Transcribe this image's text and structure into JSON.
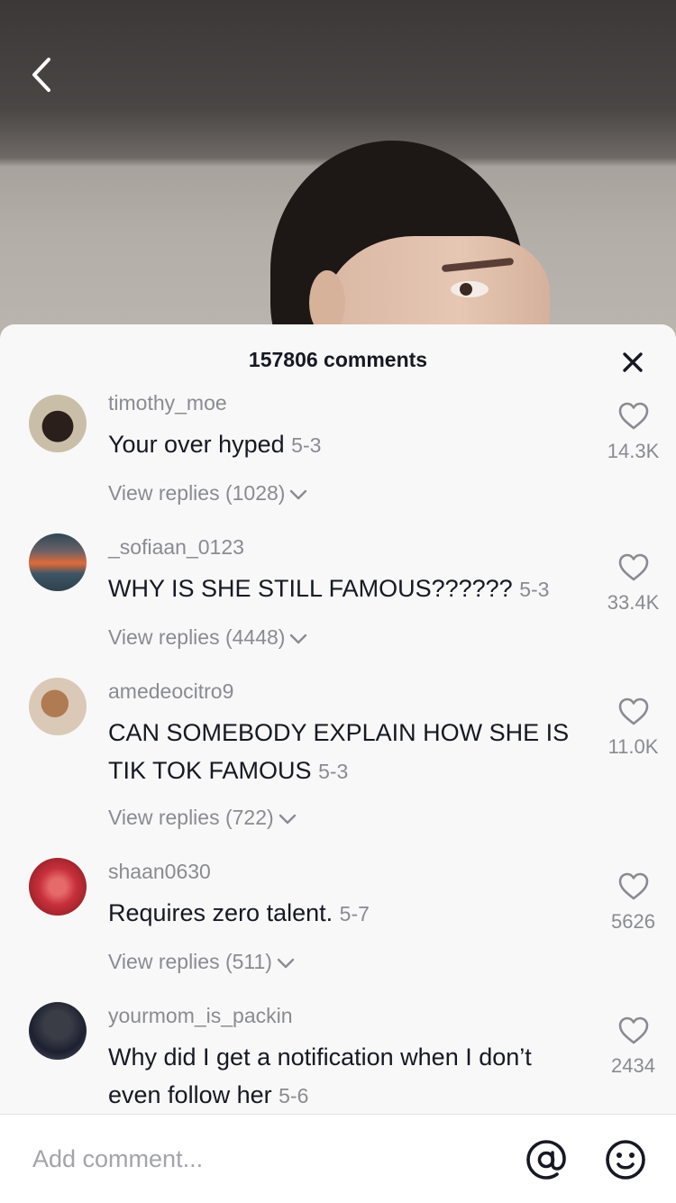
{
  "header": {
    "comment_count": "157806 comments"
  },
  "comments": [
    {
      "username": "timothy_moe",
      "text": "Your over hyped",
      "date": "5-3",
      "replies": "View replies (1028)",
      "likes": "14.3K"
    },
    {
      "username": "_sofiaan_0123",
      "text": "WHY IS SHE STILL FAMOUS??????",
      "date": "5-3",
      "replies": "View replies (4448)",
      "likes": "33.4K"
    },
    {
      "username": "amedeocitro9",
      "text": "CAN SOMEBODY EXPLAIN HOW SHE IS TIK TOK FAMOUS",
      "date": "5-3",
      "replies": "View replies (722)",
      "likes": "11.0K"
    },
    {
      "username": "shaan0630",
      "text": "Requires zero talent.",
      "date": "5-7",
      "replies": "View replies (511)",
      "likes": "5626"
    },
    {
      "username": "yourmom_is_packin",
      "text": "Why did I get a notification when I don’t even follow her",
      "date": "5-6",
      "likes": "2434"
    }
  ],
  "input": {
    "placeholder": "Add comment..."
  },
  "icons": {
    "back": "chevron-left-icon",
    "close": "close-icon",
    "like": "heart-icon",
    "replies": "chevron-down-icon",
    "mention": "at-sign-icon",
    "emoji": "smiley-icon"
  },
  "colors": {
    "sheet_bg": "#f8f8f8",
    "text": "#161823",
    "secondary_text": "#8a8b91"
  }
}
